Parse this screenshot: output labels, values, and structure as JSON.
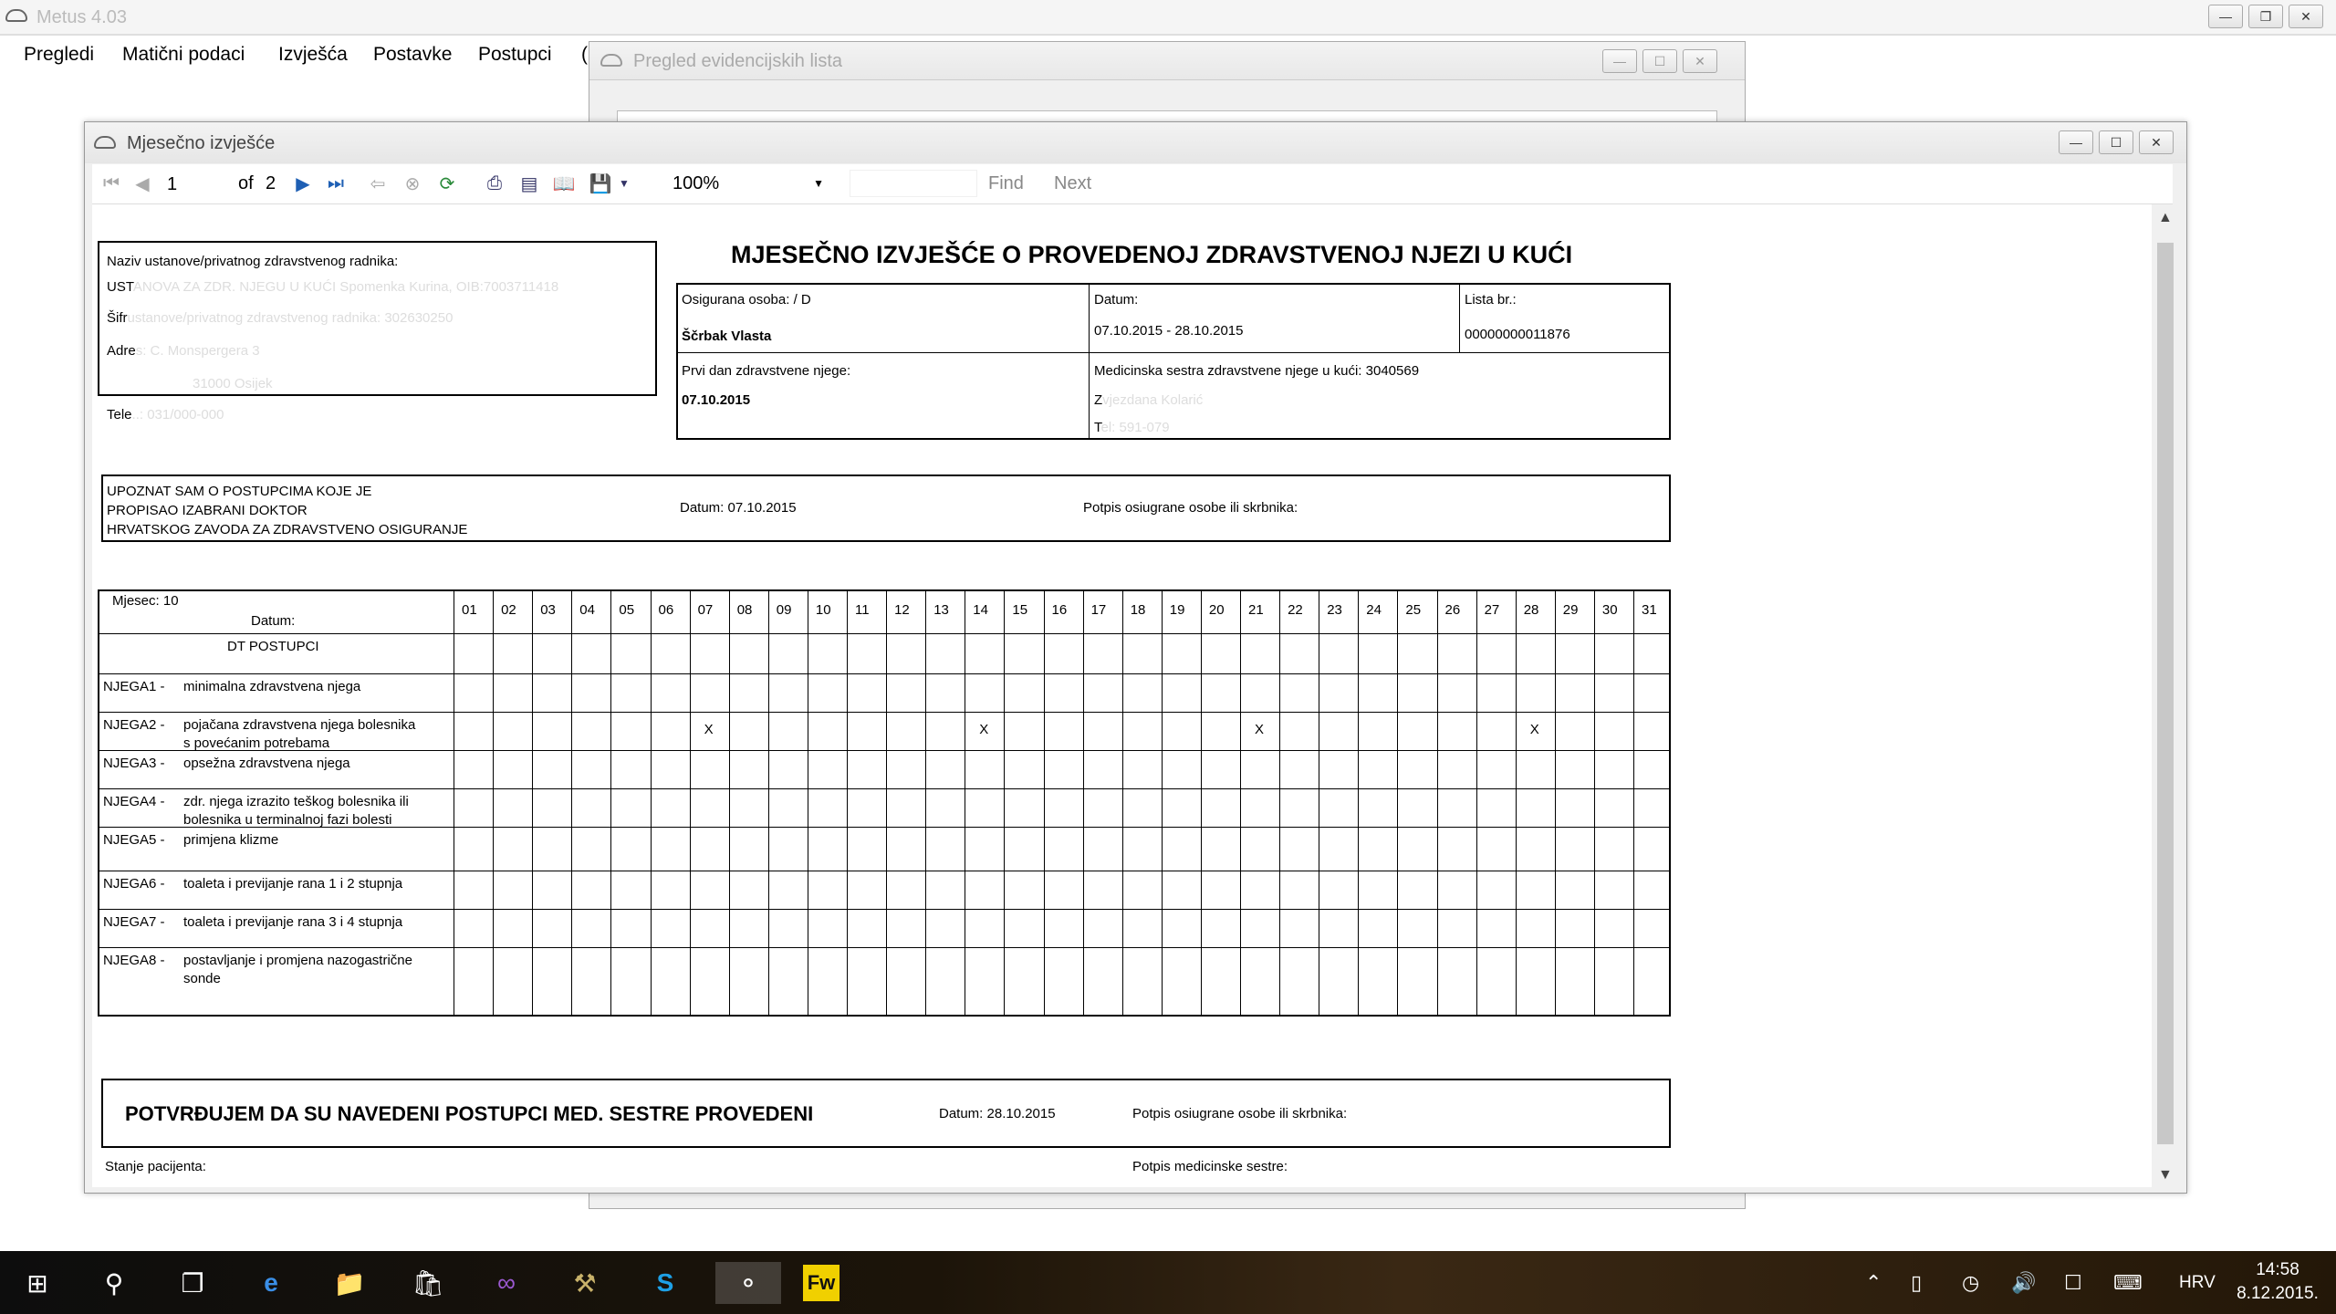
{
  "app": {
    "title": "Metus 4.03"
  },
  "menu": [
    "Pregledi",
    "Matični podaci",
    "Izvješća",
    "Postavke",
    "Postupci",
    "("
  ],
  "win2": {
    "title": "Pregled evidencijskih lista"
  },
  "win1": {
    "title": "Mjesečno izvješće"
  },
  "toolbar": {
    "page": "1",
    "of": "of",
    "total": "2",
    "zoom": "100%",
    "find": "Find",
    "next": "Next"
  },
  "report": {
    "inst_label": "Naziv ustanove/privatnog zdravstvenog radnika:",
    "inst_name_a": "UST",
    "inst_name_b": "ANOVA ZA ZDR. NJEGU U KUĆI Spomenka Kurina, OIB:7003711418",
    "sifra_a": "Šifr",
    "sifra_b": "ustanove/privatnog zdravstvenog radnika: 302630250",
    "adr_a": "Adre",
    "adr_b": "s:   C. Monspergera 3",
    "city": "31000 Osijek",
    "tel_a": "Tele",
    "tel_b": "..: 031/000-000",
    "title": "MJESEČNO IZVJEŠĆE O PROVEDENOJ ZDRAVSTVENOJ NJEZI U KUĆI",
    "osig_label": "Osigurana osoba:  / D",
    "osig_name": "Ščrbak Vlasta",
    "datum_label": "Datum:",
    "datum_val": "07.10.2015 - 28.10.2015",
    "lista_label": "Lista br.:",
    "lista_val": "00000000011876",
    "prvi_label": "Prvi dan zdravstvene njege:",
    "prvi_val": "07.10.2015",
    "med_label": "Medicinska sestra zdravstvene njege u kući: 3040569",
    "med_name_a": "Z",
    "med_name_b": "vjezdana Kolarić",
    "med_tel_a": "T",
    "med_tel_b": "el: 591-079",
    "upoznat": [
      "UPOZNAT SAM O POSTUPCIMA KOJE JE",
      "PROPISAO IZABRANI DOKTOR",
      "HRVATSKOG ZAVODA ZA ZDRAVSTVENO OSIGURANJE"
    ],
    "upoznat_datum": "Datum: 07.10.2015",
    "potpis_osig": "Potpis osiugrane osobe ili skrbnika:",
    "mjesec": "Mjesec: 10",
    "datum_hdr": "Datum:",
    "dt_postupci": "DT POSTUPCI",
    "days": [
      "01",
      "02",
      "03",
      "04",
      "05",
      "06",
      "07",
      "08",
      "09",
      "10",
      "11",
      "12",
      "13",
      "14",
      "15",
      "16",
      "17",
      "18",
      "19",
      "20",
      "21",
      "22",
      "23",
      "24",
      "25",
      "26",
      "27",
      "28",
      "29",
      "30",
      "31"
    ],
    "rows": [
      {
        "code": "NJEGA1 -",
        "desc": [
          "minimalna zdravstvena njega"
        ],
        "marks": []
      },
      {
        "code": "NJEGA2 -",
        "desc": [
          "pojačana zdravstvena njega bolesnika",
          "s povećanim potrebama"
        ],
        "marks": [
          7,
          14,
          21,
          28
        ]
      },
      {
        "code": "NJEGA3 -",
        "desc": [
          "opsežna zdravstvena njega"
        ],
        "marks": []
      },
      {
        "code": "NJEGA4 -",
        "desc": [
          "zdr. njega izrazito teškog bolesnika ili",
          "bolesnika u terminalnoj fazi bolesti"
        ],
        "marks": []
      },
      {
        "code": "NJEGA5 -",
        "desc": [
          "primjena klizme"
        ],
        "marks": []
      },
      {
        "code": "NJEGA6 -",
        "desc": [
          "toaleta i previjanje rana 1 i 2 stupnja"
        ],
        "marks": []
      },
      {
        "code": "NJEGA7 -",
        "desc": [
          "toaleta i previjanje rana 3 i 4 stupnja"
        ],
        "marks": []
      },
      {
        "code": "NJEGA8 -",
        "desc": [
          "postavljanje i promjena nazogastrične",
          "sonde"
        ],
        "marks": []
      }
    ],
    "mark": "X",
    "potvrda": "POTVRĐUJEM DA SU NAVEDENI POSTUPCI MED. SESTRE PROVEDENI",
    "potvrda_datum": "Datum: 28.10.2015",
    "potvrda_potpis": "Potpis osiugrane osobe ili skrbnika:",
    "stanje": "Stanje pacijenta:",
    "potpis_ms": "Potpis medicinske sestre:"
  },
  "taskbar": {
    "lang": "HRV",
    "time": "14:58",
    "date": "8.12.2015."
  },
  "icons": [
    "start-icon",
    "search-icon",
    "task-view-icon",
    "edge-icon",
    "file-explorer-icon",
    "store-icon",
    "visual-studio-icon",
    "tools-icon",
    "skype-icon",
    "metus-icon",
    "fireworks-icon"
  ]
}
